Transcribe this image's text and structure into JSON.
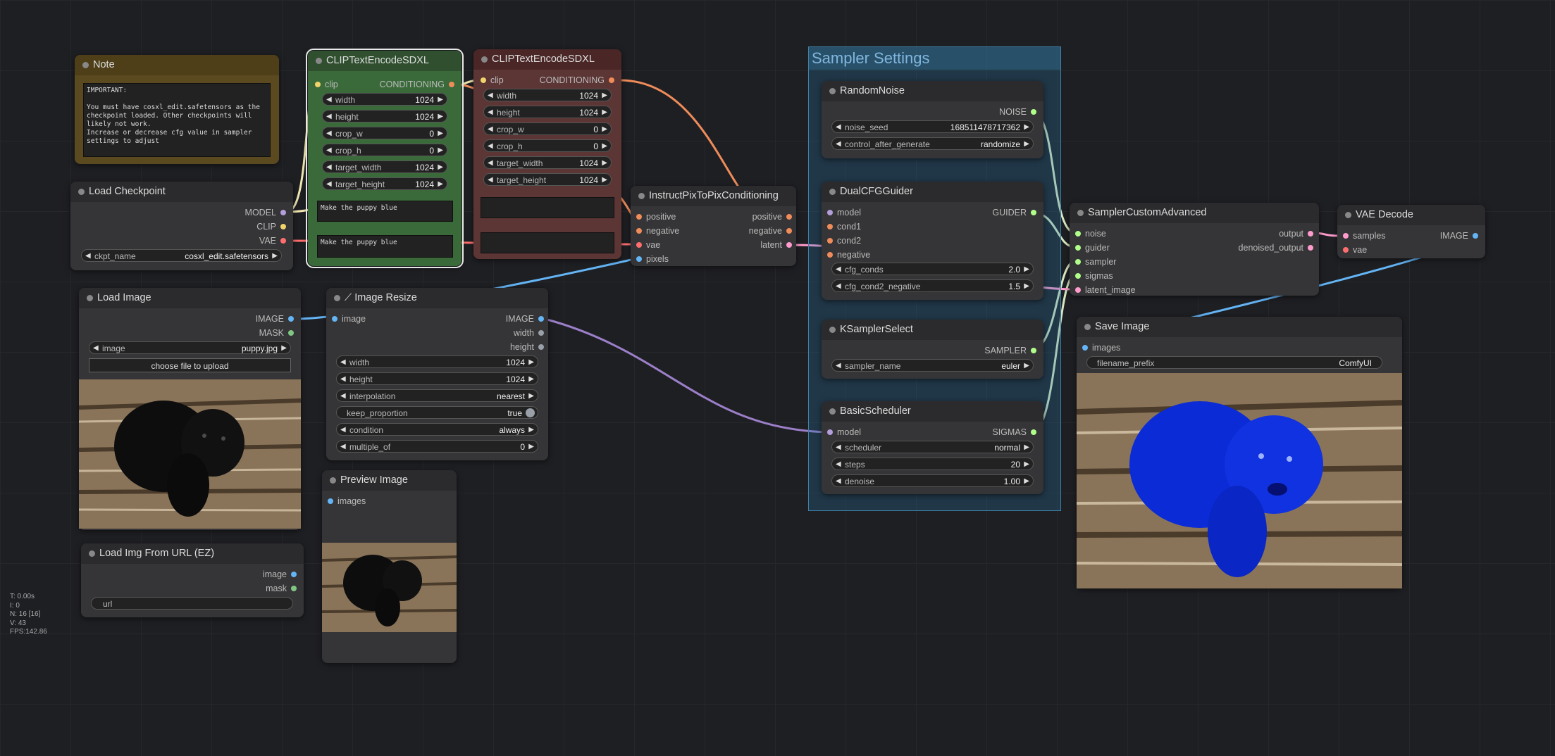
{
  "nodes": {
    "note": {
      "title": "Note",
      "text": "IMPORTANT:\n\nYou must have cosxl_edit.safetensors as the checkpoint loaded. Other checkpoints will likely not work.\nIncrease or decrease cfg value in sampler settings to adjust"
    },
    "clip1": {
      "title": "CLIPTextEncodeSDXL",
      "in_clip": "clip",
      "out_conditioning": "CONDITIONING",
      "widgets": [
        {
          "label": "width",
          "value": "1024"
        },
        {
          "label": "height",
          "value": "1024"
        },
        {
          "label": "crop_w",
          "value": "0"
        },
        {
          "label": "crop_h",
          "value": "0"
        },
        {
          "label": "target_width",
          "value": "1024"
        },
        {
          "label": "target_height",
          "value": "1024"
        }
      ],
      "text_g": "Make the puppy blue",
      "text_l": "Make the puppy blue"
    },
    "clip2": {
      "title": "CLIPTextEncodeSDXL",
      "in_clip": "clip",
      "out_conditioning": "CONDITIONING",
      "widgets": [
        {
          "label": "width",
          "value": "1024"
        },
        {
          "label": "height",
          "value": "1024"
        },
        {
          "label": "crop_w",
          "value": "0"
        },
        {
          "label": "crop_h",
          "value": "0"
        },
        {
          "label": "target_width",
          "value": "1024"
        },
        {
          "label": "target_height",
          "value": "1024"
        }
      ],
      "text_g": "",
      "text_l": ""
    },
    "checkpoint": {
      "title": "Load Checkpoint",
      "out_model": "MODEL",
      "out_clip": "CLIP",
      "out_vae": "VAE",
      "ckpt_label": "ckpt_name",
      "ckpt_value": "cosxl_edit.safetensors"
    },
    "loadimage": {
      "title": "Load Image",
      "out_image": "IMAGE",
      "out_mask": "MASK",
      "image_label": "image",
      "image_value": "puppy.jpg",
      "upload": "choose file to upload"
    },
    "resize": {
      "title": "Image Resize",
      "icon_char": "⟋",
      "in_image": "image",
      "out_image": "IMAGE",
      "out_width": "width",
      "out_height": "height",
      "widgets": [
        {
          "label": "width",
          "value": "1024"
        },
        {
          "label": "height",
          "value": "1024"
        },
        {
          "label": "interpolation",
          "value": "nearest"
        },
        {
          "label": "condition",
          "value": "always"
        },
        {
          "label": "multiple_of",
          "value": "0"
        }
      ],
      "keep_label": "keep_proportion",
      "keep_value": "true"
    },
    "preview": {
      "title": "Preview Image",
      "in_images": "images"
    },
    "url": {
      "title": "Load Img From URL (EZ)",
      "out_image": "image",
      "out_mask": "mask",
      "url_value": "url"
    },
    "ip2p": {
      "title": "InstructPixToPixConditioning",
      "in_positive": "positive",
      "in_negative": "negative",
      "in_vae": "vae",
      "in_pixels": "pixels",
      "out_positive": "positive",
      "out_negative": "negative",
      "out_latent": "latent"
    },
    "randomnoise": {
      "title": "RandomNoise",
      "out_noise": "NOISE",
      "seed_label": "noise_seed",
      "seed_value": "168511478717362",
      "cag_label": "control_after_generate",
      "cag_value": "randomize"
    },
    "guider": {
      "title": "DualCFGGuider",
      "in_model": "model",
      "in_cond1": "cond1",
      "in_cond2": "cond2",
      "in_negative": "negative",
      "out_guider": "GUIDER",
      "cfg_conds_label": "cfg_conds",
      "cfg_conds_value": "2.0",
      "cfg_neg_label": "cfg_cond2_negative",
      "cfg_neg_value": "1.5"
    },
    "ksampler": {
      "title": "KSamplerSelect",
      "out_sampler": "SAMPLER",
      "sampler_label": "sampler_name",
      "sampler_value": "euler"
    },
    "scheduler": {
      "title": "BasicScheduler",
      "in_model": "model",
      "out_sigmas": "SIGMAS",
      "sched_label": "scheduler",
      "sched_value": "normal",
      "steps_label": "steps",
      "steps_value": "20",
      "denoise_label": "denoise",
      "denoise_value": "1.00"
    },
    "samplercustom": {
      "title": "SamplerCustomAdvanced",
      "in_noise": "noise",
      "in_guider": "guider",
      "in_sampler": "sampler",
      "in_sigmas": "sigmas",
      "in_latent": "latent_image",
      "out_output": "output",
      "out_denoised": "denoised_output"
    },
    "vaedecode": {
      "title": "VAE Decode",
      "in_samples": "samples",
      "in_vae": "vae",
      "out_image": "IMAGE"
    },
    "saveimage": {
      "title": "Save Image",
      "in_images": "images",
      "prefix_label": "filename_prefix",
      "prefix_value": "ComfyUI"
    }
  },
  "group": {
    "title": "Sampler Settings"
  },
  "stats": {
    "t": "T: 0.00s",
    "i": "I: 0",
    "n": "N: 16 [16]",
    "v": "V: 43",
    "fps": "FPS:142.86"
  },
  "colors": {
    "clip": "#f1d36b",
    "conditioning": "#f08c5a",
    "model": "#b39ddb",
    "vae": "#ff6e6e",
    "image": "#64b5f6",
    "latent": "#ff9ccd",
    "noise": "#b0ff8a",
    "mask": "#81c784"
  }
}
